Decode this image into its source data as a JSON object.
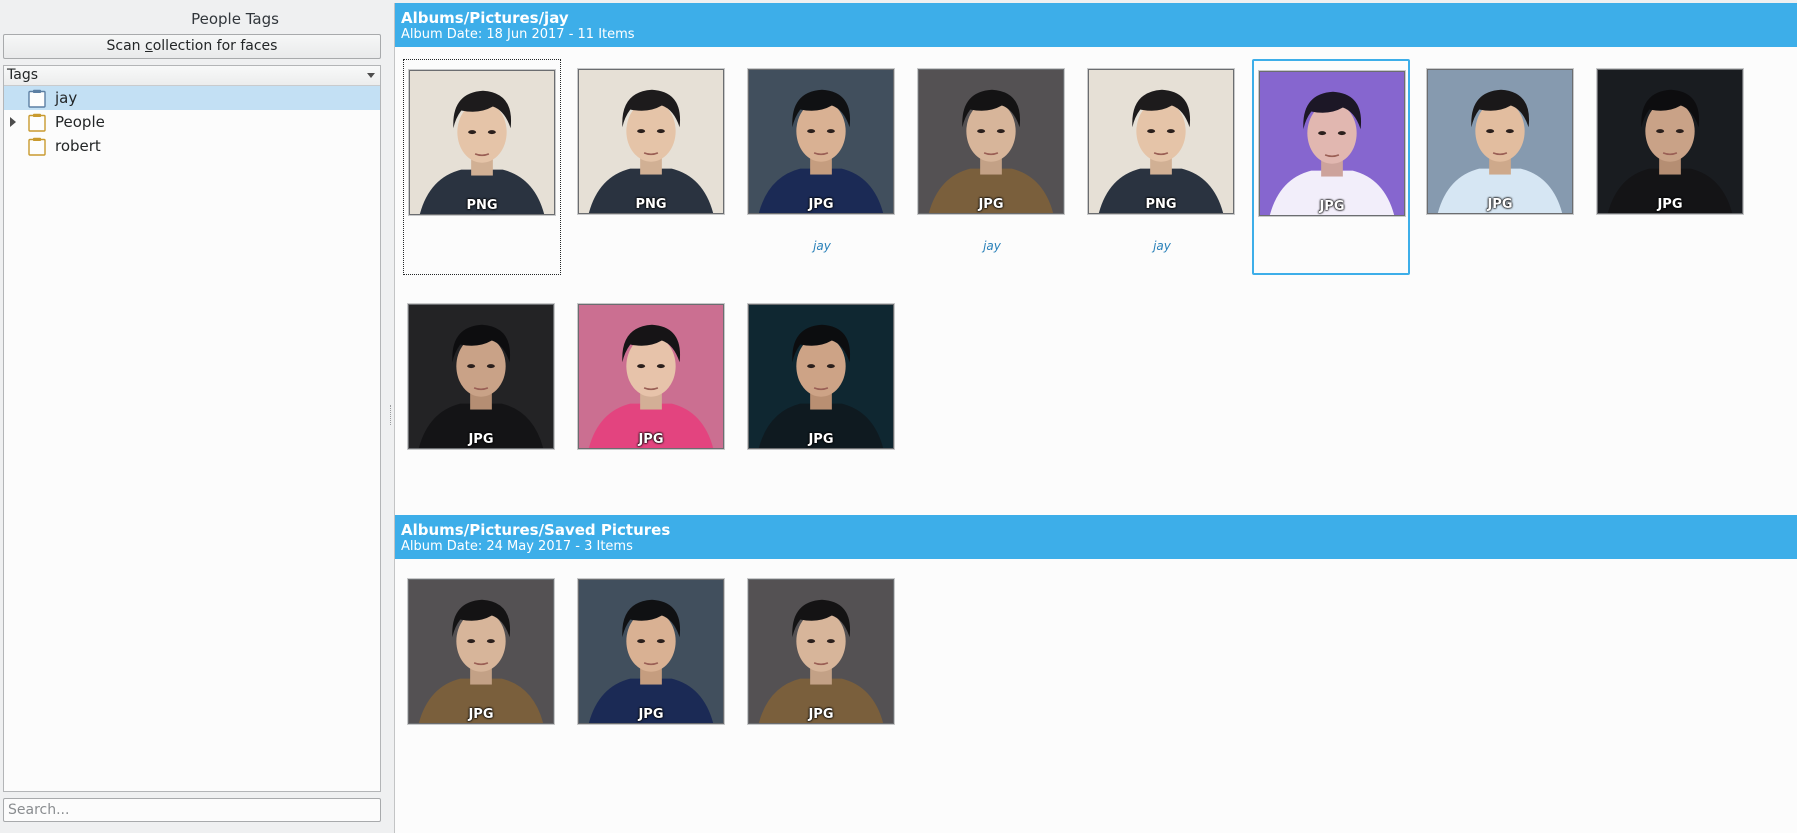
{
  "sidebar": {
    "title": "People Tags",
    "scan_button": {
      "before": "Scan ",
      "mnemonic": "c",
      "after": "ollection for faces"
    },
    "tree_header": "Tags",
    "tags": [
      {
        "label": "jay",
        "selected": true,
        "expandable": false
      },
      {
        "label": "People",
        "selected": false,
        "expandable": true
      },
      {
        "label": "robert",
        "selected": false,
        "expandable": false
      }
    ],
    "search_placeholder": "Search..."
  },
  "albums": [
    {
      "title": "Albums/Pictures/jay",
      "subtitle": "Album Date: 18 Jun 2017 - 11 Items",
      "items": [
        {
          "format": "PNG",
          "face_tag": "",
          "bg": "#efe9df",
          "style": "light"
        },
        {
          "format": "PNG",
          "face_tag": "",
          "bg": "#efe9df",
          "style": "light"
        },
        {
          "format": "JPG",
          "face_tag": "jay",
          "bg": "#4b5866",
          "style": "dark"
        },
        {
          "format": "JPG",
          "face_tag": "jay",
          "bg": "#5d5a5c",
          "style": "grey"
        },
        {
          "format": "PNG",
          "face_tag": "jay",
          "bg": "#efe9df",
          "style": "light"
        },
        {
          "format": "JPG",
          "face_tag": "",
          "bg": "#8f6fd8",
          "style": "purple"
        },
        {
          "format": "JPG",
          "face_tag": "",
          "bg": "#8fa3b8",
          "style": "blue"
        },
        {
          "format": "JPG",
          "face_tag": "",
          "bg": "#232529",
          "style": "black"
        },
        {
          "format": "JPG",
          "face_tag": "",
          "bg": "#2c2c2e",
          "style": "black"
        },
        {
          "format": "JPG",
          "face_tag": "",
          "bg": "#d4789a",
          "style": "pink"
        },
        {
          "format": "JPG",
          "face_tag": "",
          "bg": "#17303a",
          "style": "teal"
        }
      ]
    },
    {
      "title": "Albums/Pictures/Saved Pictures",
      "subtitle": "Album Date: 24 May 2017 - 3 Items",
      "items": [
        {
          "format": "JPG",
          "face_tag": "",
          "bg": "#5d5a5c",
          "style": "grey"
        },
        {
          "format": "JPG",
          "face_tag": "",
          "bg": "#4b5866",
          "style": "dark"
        },
        {
          "format": "JPG",
          "face_tag": "",
          "bg": "#5d5a5c",
          "style": "grey"
        }
      ]
    }
  ],
  "colors": {
    "accent": "#3daee9",
    "selection": "#c3e0f4",
    "face_tag_text": "#2980b9"
  }
}
